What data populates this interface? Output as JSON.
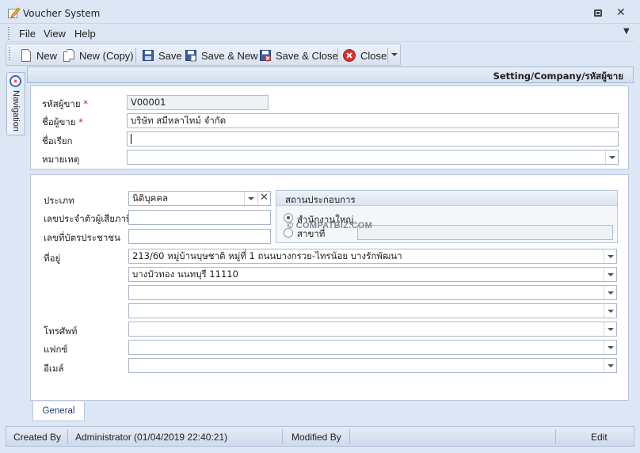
{
  "window": {
    "title": "Voucher System"
  },
  "menu": {
    "items": [
      "File",
      "View",
      "Help"
    ]
  },
  "toolbar": {
    "new": "New",
    "new_copy": "New (Copy)",
    "save": "Save",
    "save_new": "Save & New",
    "save_close": "Save & Close",
    "close": "Close"
  },
  "nav": {
    "label": "Navigation"
  },
  "header": {
    "breadcrumb": "Setting/Company/รหัสผู้ขาย"
  },
  "form_top": {
    "code_label": "รหัสผู้ขาย",
    "code_value": "V00001",
    "name_label": "ชื่อผู้ขาย",
    "name_value": "บริษัท สมีหลาไทม์ จำกัด",
    "alias_label": "ชื่อเรียก",
    "alias_value": "",
    "note_label": "หมายเหตุ",
    "note_value": "",
    "required_mark": "*"
  },
  "form_bottom": {
    "type_label": "ประเภท",
    "type_value": "นิติบุคคล",
    "taxid_label": "เลขประจำตัวผู้เสียภาษี",
    "taxid_value": "",
    "idcard_label": "เลขที่บัตรประชาชน",
    "idcard_value": "",
    "address_label": "ที่อยู่",
    "address_lines": [
      "213/60 หมู่บ้านบุษชาติ หมู่ที่ 1 ถนนบางกรวย-ไทรน้อย  บางรักพัฒนา",
      "บางบัวทอง นนทบุรี 11110",
      "",
      ""
    ],
    "phone_label": "โทรศัพท์",
    "phone_value": "",
    "fax_label": "แฟกซ์",
    "fax_value": "",
    "email_label": "อีเมล์",
    "email_value": ""
  },
  "establishment": {
    "title": "สถานประกอบการ",
    "head_office": "สำนักงานใหญ่",
    "branch": "สาขาที่",
    "branch_value": "",
    "selected": "head_office"
  },
  "watermark": "© COMPATBIZ.COM",
  "tabs": {
    "general": "General"
  },
  "status": {
    "created_by_label": "Created By",
    "created_by_value": "Administrator (01/04/2019 22:40:21)",
    "modified_by_label": "Modified By",
    "mode": "Edit"
  }
}
